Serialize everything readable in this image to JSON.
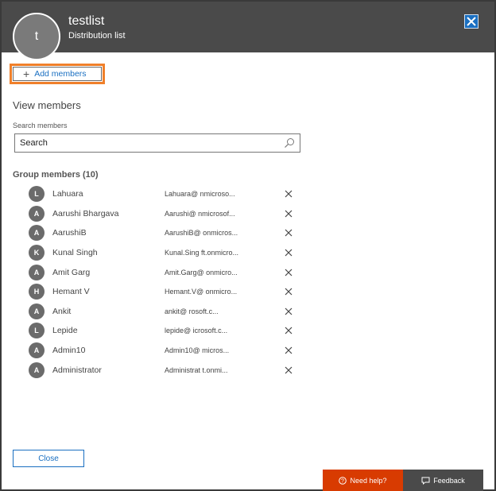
{
  "header": {
    "avatar_initial": "t",
    "title": "testlist",
    "subtitle": "Distribution list",
    "close_label": "✖"
  },
  "actions": {
    "add_members_label": "Add members"
  },
  "view": {
    "heading": "View members",
    "search_label": "Search members",
    "search_value": "Search"
  },
  "group": {
    "heading": "Group members (10)",
    "members": [
      {
        "initial": "L",
        "name": "Lahuara",
        "email": "Lahuara@            nmicroso..."
      },
      {
        "initial": "A",
        "name": "Aarushi Bhargava",
        "email": "Aarushi@            nmicrosof..."
      },
      {
        "initial": "A",
        "name": "AarushiB",
        "email": "AarushiB@            onmicros..."
      },
      {
        "initial": "K",
        "name": "Kunal Singh",
        "email": "Kunal.Sing            ft.onmicro..."
      },
      {
        "initial": "A",
        "name": "Amit Garg",
        "email": "Amit.Garg@            onmicro..."
      },
      {
        "initial": "H",
        "name": "Hemant V",
        "email": "Hemant.V@            onmicro..."
      },
      {
        "initial": "A",
        "name": "Ankit",
        "email": "ankit@            rosoft.c..."
      },
      {
        "initial": "L",
        "name": "Lepide",
        "email": "lepide@            icrosoft.c..."
      },
      {
        "initial": "A",
        "name": "Admin10",
        "email": "Admin10@            micros..."
      },
      {
        "initial": "A",
        "name": "Administrator",
        "email": "Administrat            t.onmi..."
      }
    ]
  },
  "footer": {
    "close_label": "Close",
    "help_label": "Need help?",
    "feedback_label": "Feedback"
  },
  "colors": {
    "header_bg": "#4a4a4a",
    "accent": "#1a6fc1",
    "highlight": "#f0802a",
    "help_bg": "#d83b01"
  }
}
